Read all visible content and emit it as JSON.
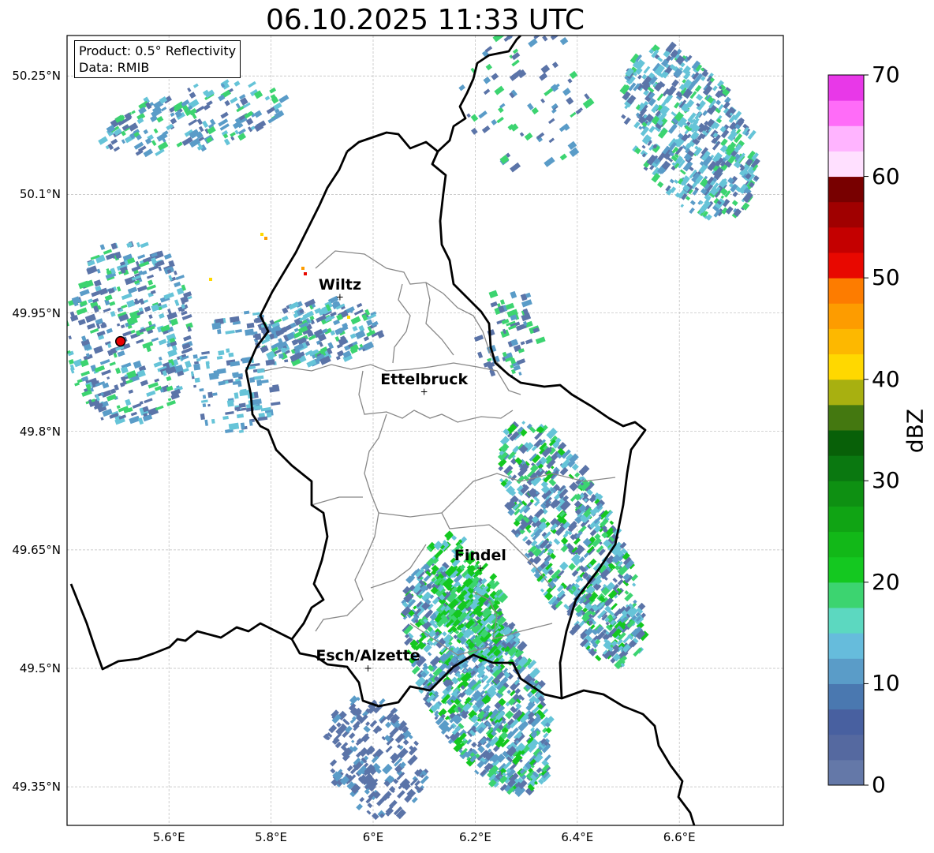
{
  "title": "06.10.2025 11:33 UTC",
  "info": {
    "product": "Product: 0.5° Reflectivity",
    "data_source": "Data: RMIB"
  },
  "lat_labels": [
    {
      "lat": 50.25,
      "text": "50.25°N"
    },
    {
      "lat": 50.1,
      "text": "50.1°N"
    },
    {
      "lat": 49.95,
      "text": "49.95°N"
    },
    {
      "lat": 49.8,
      "text": "49.8°N"
    },
    {
      "lat": 49.65,
      "text": "49.65°N"
    },
    {
      "lat": 49.5,
      "text": "49.5°N"
    },
    {
      "lat": 49.35,
      "text": "49.35°N"
    }
  ],
  "lon_labels": [
    {
      "lon": 5.6,
      "text": "5.6°E"
    },
    {
      "lon": 5.8,
      "text": "5.8°E"
    },
    {
      "lon": 6.0,
      "text": "6°E"
    },
    {
      "lon": 6.2,
      "text": "6.2°E"
    },
    {
      "lon": 6.4,
      "text": "6.4°E"
    },
    {
      "lon": 6.6,
      "text": "6.6°E"
    }
  ],
  "cities": [
    {
      "name": "Wiltz",
      "lat": 49.97,
      "lon": 5.935
    },
    {
      "name": "Ettelbruck",
      "lat": 49.85,
      "lon": 6.1
    },
    {
      "name": "Findel",
      "lat": 49.627,
      "lon": 6.21
    },
    {
      "name": "Esch/Alzette",
      "lat": 49.5,
      "lon": 5.99
    }
  ],
  "radar_site": {
    "lat": 49.914,
    "lon": 5.505
  },
  "colorbar": {
    "label": "dBZ",
    "min": 0,
    "max": 70,
    "ticks": [
      {
        "value": 70,
        "text": "70"
      },
      {
        "value": 60,
        "text": "60"
      },
      {
        "value": 50,
        "text": "50"
      },
      {
        "value": 40,
        "text": "40"
      },
      {
        "value": 30,
        "text": "30"
      },
      {
        "value": 20,
        "text": "20"
      },
      {
        "value": 10,
        "text": "10"
      },
      {
        "value": 0,
        "text": "0"
      }
    ],
    "colors": [
      "#6478a8",
      "#5569a0",
      "#4860a0",
      "#4a78b0",
      "#5a9cc8",
      "#66bcdc",
      "#5cd8c0",
      "#3cd470",
      "#14c820",
      "#12b818",
      "#10a414",
      "#0e9012",
      "#0a7810",
      "#086008",
      "#447810",
      "#a8b010",
      "#ffd800",
      "#fdb800",
      "#fd9c00",
      "#fd7c00",
      "#e80800",
      "#c40000",
      "#a00000",
      "#780000",
      "#ffe0ff",
      "#ffb4ff",
      "#ff6cf8",
      "#e838e8"
    ]
  },
  "echo_colors": {
    "weak": "#5b74a8",
    "light": "#5a9cc8",
    "moderate": "#66c4d8",
    "green": "#3cd470",
    "strong_green": "#14c820",
    "yellow": "#ffd800",
    "orange": "#fd9c00",
    "red": "#e80800"
  }
}
